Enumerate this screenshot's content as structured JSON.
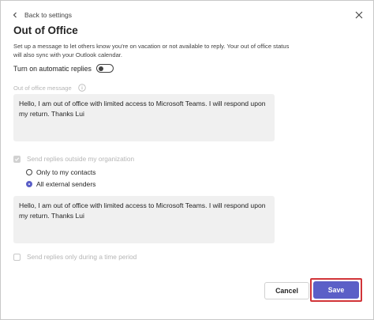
{
  "header": {
    "back_label": "Back to settings",
    "title": "Out of Office",
    "description": "Set up a message to let others know you're on vacation or not available to reply. Your out of office status will also sync with your Outlook calendar."
  },
  "auto_replies": {
    "label": "Turn on automatic replies",
    "enabled": false
  },
  "internal_message": {
    "label": "Out of office message",
    "value": "Hello, I am out of office with limited access to Microsoft Teams. I will respond upon my return. Thanks Lui"
  },
  "outside_org": {
    "label": "Send replies outside my organization",
    "checked": true,
    "options": [
      {
        "label": "Only to my contacts",
        "selected": false
      },
      {
        "label": "All external senders",
        "selected": true
      }
    ],
    "message_value": "Hello, I am out of office with limited access to Microsoft Teams. I will respond upon my return. Thanks Lui"
  },
  "time_period": {
    "label": "Send replies only during a time period",
    "checked": false
  },
  "footer": {
    "cancel_label": "Cancel",
    "save_label": "Save"
  },
  "colors": {
    "accent": "#5b5fc7",
    "highlight": "#d13438",
    "disabled_text": "#b5b5b5"
  }
}
